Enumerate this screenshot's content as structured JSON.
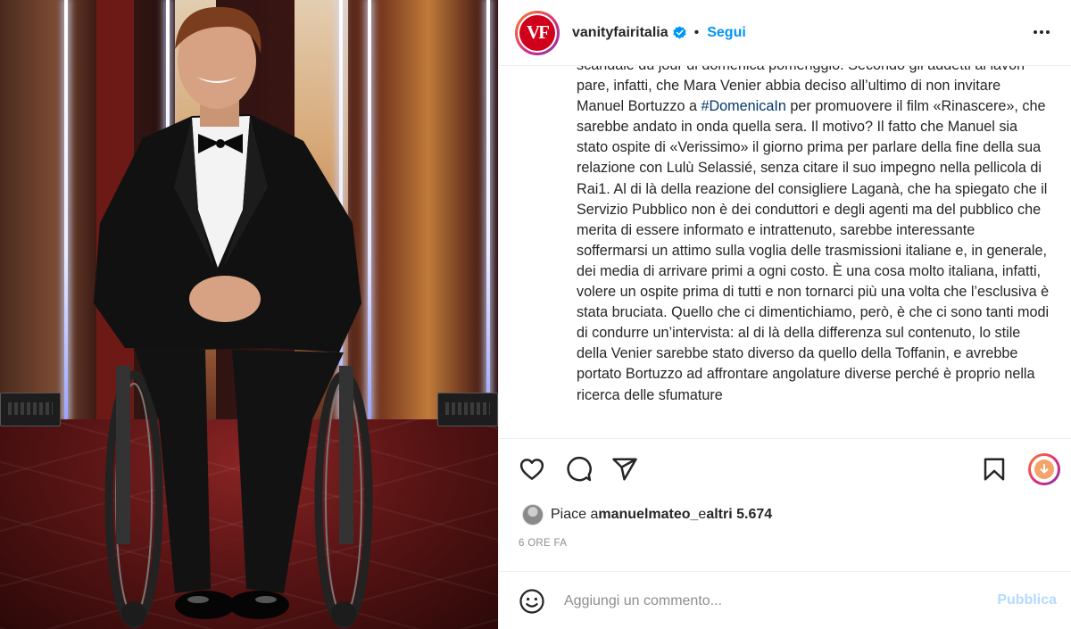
{
  "post": {
    "avatar_text": "VF",
    "username": "vanityfairitalia",
    "separator": "•",
    "follow_label": "Segui",
    "caption_parts": [
      "scandale du jour di domenica pomeriggio. Secondo gli addetti ai lavori pare, infatti, che Mara Venier abbia deciso all’ultimo di non invitare Manuel Bortuzzo a ",
      "#DomenicaIn",
      " per promuovere il film «Rinascere», che sarebbe andato in onda quella sera. Il motivo? Il fatto che Manuel sia stato ospite di «Verissimo» il giorno prima per parlare della fine della sua relazione con Lulù Selassié, senza citare il suo impegno nella pellicola di Rai1. Al di là della reazione del consigliere Laganà, che ha spiegato che il Servizio Pubblico non è dei conduttori e degli agenti ma del pubblico che merita di essere informato e intrattenuto, sarebbe interessante soffermarsi un attimo sulla voglia delle trasmissioni italiane e, in generale, dei media di arrivare primi a ogni costo. È una cosa molto italiana, infatti, volere un ospite prima di tutti e non tornarci più una volta che l’esclusiva è stata bruciata. Quello che ci dimentichiamo, però, è che ci sono tanti modi di condurre un’intervista: al di là della differenza sul contenuto, lo stile della Venier sarebbe stato diverso da quello della Toffanin, e avrebbe portato Bortuzzo ad affrontare angolature diverse perché è proprio nella ricerca delle sfumature"
    ],
    "likes_prefix": "Piace a ",
    "likes_user": "manuelmateo_",
    "likes_middle": " e ",
    "likes_count": "altri 5.674",
    "time_ago": "6 ORE FA"
  },
  "comment": {
    "placeholder": "Aggiungi un commento...",
    "publish_label": "Pubblica"
  },
  "icons": {
    "like": "heart-icon",
    "comment": "comment-icon",
    "share": "share-icon",
    "save": "bookmark-icon",
    "download": "download-icon",
    "emoji": "emoji-icon",
    "more": "more-options-icon",
    "verified": "verified-badge-icon"
  },
  "colors": {
    "link_blue": "#0095f6",
    "hashtag_blue": "#00376b",
    "publish_disabled": "#b3dbff",
    "brand_red": "#d0021b",
    "text": "#262626",
    "muted": "#8e8e8e"
  }
}
